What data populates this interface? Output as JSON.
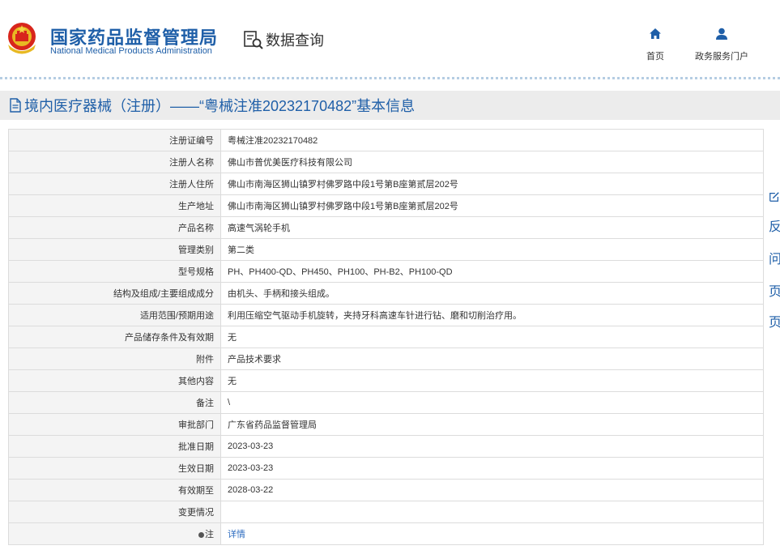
{
  "header": {
    "org_cn": "国家药品监督管理局",
    "org_en": "National Medical Products Administration",
    "query_label": "数据查询",
    "nav": [
      {
        "label": "首页",
        "icon": "home-icon"
      },
      {
        "label": "政务服务门户",
        "icon": "user-icon"
      }
    ]
  },
  "title": "境内医疗器械（注册）——“粤械注准20232170482”基本信息",
  "rows": [
    {
      "label": "注册证编号",
      "value": "粤械注准20232170482"
    },
    {
      "label": "注册人名称",
      "value": "佛山市普优美医疗科技有限公司"
    },
    {
      "label": "注册人住所",
      "value": "佛山市南海区狮山镇罗村佛罗路中段1号第B座第贰层202号"
    },
    {
      "label": "生产地址",
      "value": "佛山市南海区狮山镇罗村佛罗路中段1号第B座第贰层202号"
    },
    {
      "label": "产品名称",
      "value": "高速气涡轮手机"
    },
    {
      "label": "管理类别",
      "value": "第二类"
    },
    {
      "label": "型号规格",
      "value": "PH、PH400-QD、PH450、PH100、PH-B2、PH100-QD"
    },
    {
      "label": "结构及组成/主要组成成分",
      "value": "由机头、手柄和接头组成。"
    },
    {
      "label": "适用范围/预期用途",
      "value": "利用压缩空气驱动手机旋转，夹持牙科高速车针进行钻、磨和切削治疗用。"
    },
    {
      "label": "产品储存条件及有效期",
      "value": "无"
    },
    {
      "label": "附件",
      "value": "产品技术要求"
    },
    {
      "label": "其他内容",
      "value": "无"
    },
    {
      "label": "备注",
      "value": "\\"
    },
    {
      "label": "审批部门",
      "value": "广东省药品监督管理局"
    },
    {
      "label": "批准日期",
      "value": "2023-03-23"
    },
    {
      "label": "生效日期",
      "value": "2023-03-23"
    },
    {
      "label": "有效期至",
      "value": "2028-03-22"
    },
    {
      "label": "变更情况",
      "value": ""
    },
    {
      "label": "注",
      "value": "详情"
    }
  ],
  "side_tools": [
    "反",
    "问",
    "页",
    "页"
  ],
  "colors": {
    "brand_blue": "#1f5fa8",
    "link_blue": "#2d6cc0",
    "label_bg": "#f4f4f4",
    "titlebar_bg": "#ececec"
  }
}
